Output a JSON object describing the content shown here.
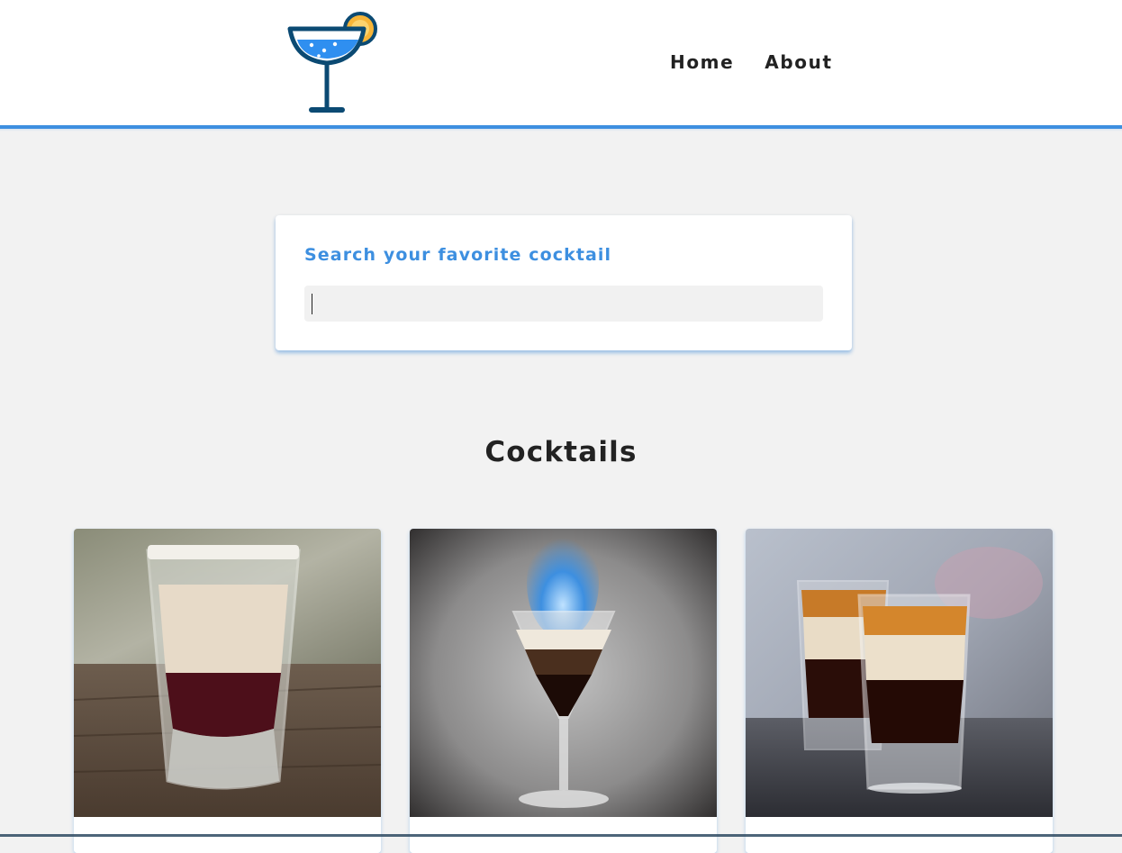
{
  "brand": {
    "logo_icon": "cocktail-glass-icon",
    "colors": {
      "accent": "#3d8fe0",
      "glass_outline": "#0b4a73",
      "drink": "#2f8ff0",
      "lemon": "#f7b538"
    }
  },
  "nav": {
    "links": [
      {
        "label": "Home"
      },
      {
        "label": "About"
      }
    ]
  },
  "search": {
    "label": "Search your favorite cocktail",
    "value": "",
    "placeholder": ""
  },
  "section": {
    "title": "Cocktails"
  },
  "cocktails": [
    {
      "image": "layered-shot-cream-over-red-photo"
    },
    {
      "image": "flaming-layered-cocktail-photo"
    },
    {
      "image": "b52-layered-shots-photo"
    }
  ]
}
